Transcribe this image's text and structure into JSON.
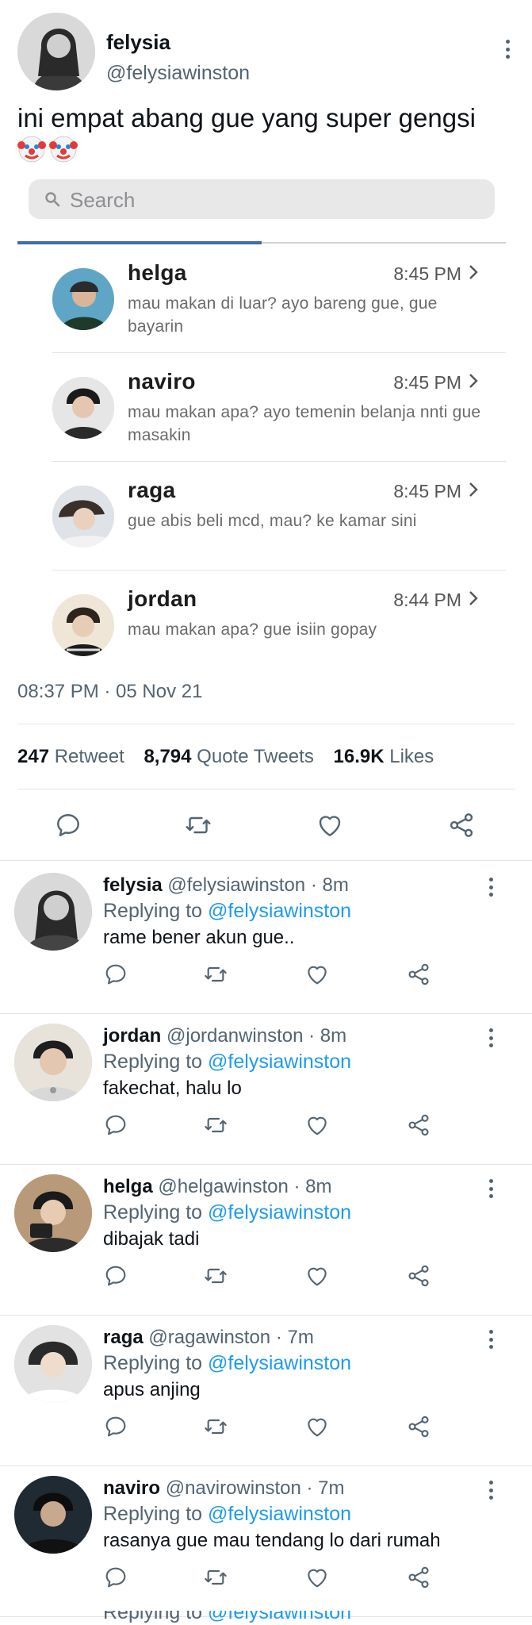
{
  "main_tweet": {
    "name": "felysia",
    "handle": "@felysiawinston",
    "text": "ini empat abang gue yang super gengsi",
    "emoji": "clown-face ×2",
    "timestamp": "08:37 PM · 05 Nov 21",
    "stats": {
      "retweets_count": "247",
      "retweets_label": "Retweet",
      "quotes_count": "8,794",
      "quotes_label": "Quote Tweets",
      "likes_count": "16.9K",
      "likes_label": "Likes"
    }
  },
  "chat_screenshot": {
    "search_placeholder": "Search",
    "chats": [
      {
        "name": "helga",
        "time": "8:45 PM",
        "message": "mau makan di luar? ayo bareng gue, gue bayarin"
      },
      {
        "name": "naviro",
        "time": "8:45 PM",
        "message": "mau makan apa? ayo temenin belanja nnti gue masakin"
      },
      {
        "name": "raga",
        "time": "8:45 PM",
        "message": "gue abis beli mcd, mau? ke kamar sini"
      },
      {
        "name": "jordan",
        "time": "8:44 PM",
        "message": "mau makan apa? gue isiin gopay"
      }
    ]
  },
  "replies": [
    {
      "name": "felysia",
      "handle": "@felysiawinston",
      "age": "8m",
      "replying_label": "Replying to",
      "replying_to": "@felysiawinston",
      "text": "rame bener akun gue.."
    },
    {
      "name": "jordan",
      "handle": "@jordanwinston",
      "age": "8m",
      "replying_label": "Replying to",
      "replying_to": "@felysiawinston",
      "text": "fakechat, halu lo"
    },
    {
      "name": "helga",
      "handle": "@helgawinston",
      "age": "8m",
      "replying_label": "Replying to",
      "replying_to": "@felysiawinston",
      "text": "dibajak tadi"
    },
    {
      "name": "raga",
      "handle": "@ragawinston",
      "age": "7m",
      "replying_label": "Replying to",
      "replying_to": "@felysiawinston",
      "text": "apus anjing"
    },
    {
      "name": "naviro",
      "handle": "@navirowinston",
      "age": "7m",
      "replying_label": "Replying to",
      "replying_to": "@felysiawinston",
      "text": "rasanya gue mau tendang lo dari rumah"
    }
  ],
  "cut_off_reply": {
    "replying_label": "Replying to",
    "replying_to": "@felysiawinston"
  },
  "colors": {
    "link": "#1d9bf0",
    "secondary_text": "#536471",
    "tab_indicator": "#3d6da8"
  },
  "icons": [
    "more-vertical-icon",
    "search-icon",
    "chevron-right-icon",
    "reply-icon",
    "retweet-icon",
    "like-icon",
    "share-icon"
  ]
}
